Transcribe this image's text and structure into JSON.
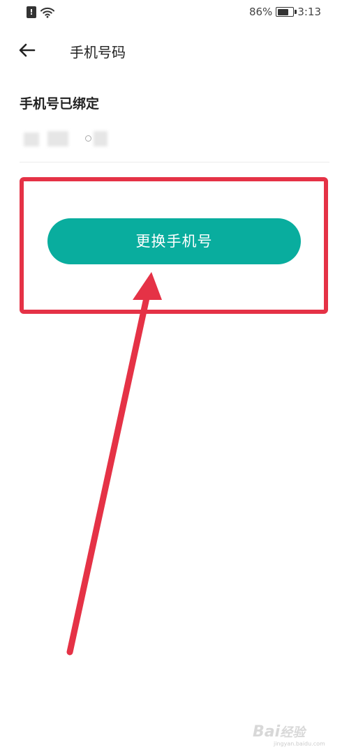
{
  "status_bar": {
    "sim_label": "!",
    "battery_level": 0.86,
    "battery_text": "86%",
    "time": "3:13",
    "icons": [
      "sim-alert-icon",
      "wifi-icon",
      "battery-icon"
    ]
  },
  "header": {
    "back_icon": "arrow-left-icon",
    "title": "手机号码"
  },
  "section": {
    "title": "手机号已绑定"
  },
  "actions": {
    "change_phone_label": "更换手机号"
  },
  "colors": {
    "button_bg": "#09ad9e",
    "annotation_red": "#e53246"
  },
  "watermark": {
    "brand": "Bai",
    "brand_cn": "经验",
    "domain": "jingyan.baidu.com"
  }
}
